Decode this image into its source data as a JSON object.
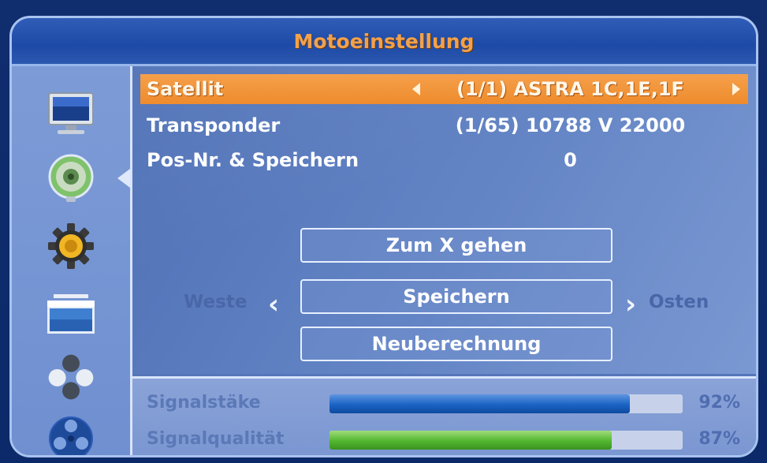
{
  "title": "Motoeinstellung",
  "sidebar": {
    "items": [
      {
        "icon": "tv-icon"
      },
      {
        "icon": "satellite-dish-icon"
      },
      {
        "icon": "gear-icon"
      },
      {
        "icon": "media-window-icon"
      },
      {
        "icon": "cluster-icon"
      },
      {
        "icon": "film-reel-icon"
      }
    ]
  },
  "settings": {
    "rows": [
      {
        "label": "Satellit",
        "value": "(1/1) ASTRA 1C,1E,1F"
      },
      {
        "label": "Transponder",
        "value": "(1/65) 10788 V 22000"
      },
      {
        "label": "Pos-Nr. & Speichern",
        "value": "0"
      }
    ]
  },
  "buttons": {
    "goto": "Zum X gehen",
    "save": "Speichern",
    "recalc": "Neuberechnung"
  },
  "direction": {
    "west": "Weste",
    "east": "Osten"
  },
  "signal": {
    "strength_label": "Signalstäke",
    "strength_percent": "92%",
    "strength_value": 0.85,
    "quality_label": "Signalqualität",
    "quality_percent": "87%",
    "quality_value": 0.8
  },
  "colors": {
    "accent_orange": "#f0902f",
    "strength_bar": "#1a63c4",
    "quality_bar": "#53b630"
  }
}
